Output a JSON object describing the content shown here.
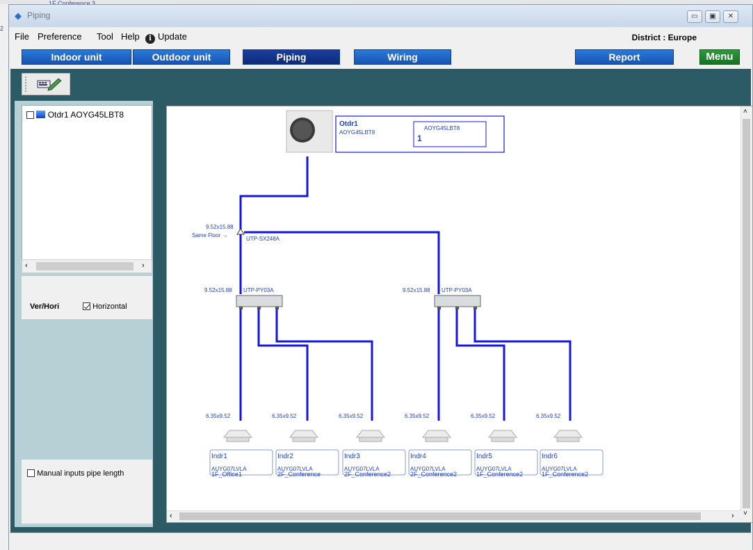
{
  "window": {
    "title": "Piping"
  },
  "background": {
    "link_text": "2",
    "snippet_text": "1F Conference 3"
  },
  "menu": {
    "items": [
      "File",
      "Preference",
      "Tool",
      "Help"
    ],
    "update_label": "Update",
    "district": "District : Europe"
  },
  "nav": {
    "buttons": [
      "Indoor unit",
      "Outdoor unit",
      "Piping",
      "Wiring",
      "Report"
    ],
    "active": "Piping",
    "menu_label": "Menu"
  },
  "tree": {
    "item_label": "Otdr1 AOYG45LBT8"
  },
  "options": {
    "verhori_label": "Ver/Hori",
    "horizontal_label": "Horizontal",
    "horizontal_checked": true,
    "manual_label": "Manual inputs pipe length",
    "manual_checked": false
  },
  "diagram": {
    "outdoor": {
      "name": "Otdr1",
      "model": "AOYG45LBT8",
      "box_model": "AOYG45LBT8",
      "box_count": "1"
    },
    "main_pipe": {
      "size": "9.52x15.88",
      "floor_label": "Same Floor",
      "joint": "UTP-SX248A"
    },
    "headers": [
      {
        "size": "9.52x15.88",
        "model": "UTP-PY03A"
      },
      {
        "size": "9.52x15.88",
        "model": "UTP-PY03A"
      }
    ],
    "indoor": [
      {
        "name": "Indr1",
        "model": "AUYG07LVLA",
        "room": "1F_Office1",
        "pipe": "6.35x9.52"
      },
      {
        "name": "Indr2",
        "model": "AUYG07LVLA",
        "room": "2F_Conference",
        "pipe": "6.35x9.52"
      },
      {
        "name": "Indr3",
        "model": "AUYG07LVLA",
        "room": "2F_Conference2",
        "pipe": "6.35x9.52"
      },
      {
        "name": "Indr4",
        "model": "AUYG07LVLA",
        "room": "2F_Conference2",
        "pipe": "6.35x9.52"
      },
      {
        "name": "Indr5",
        "model": "AUYG07LVLA",
        "room": "1F_Conference2",
        "pipe": "6.35x9.52"
      },
      {
        "name": "Indr6",
        "model": "AUYG07LVLA",
        "room": "1F_Conference2",
        "pipe": "6.35x9.52"
      }
    ]
  },
  "colors": {
    "pipe": "#1414e6",
    "label": "#1f3fd6",
    "nav_blue": "#1852b4",
    "menu_green": "#177224",
    "teal": "#2c5b66"
  }
}
